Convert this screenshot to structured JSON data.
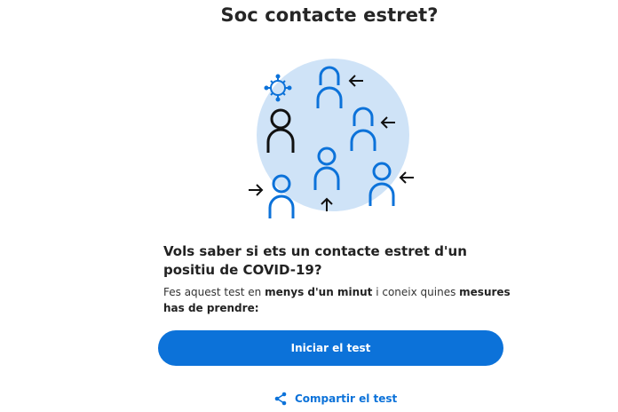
{
  "page": {
    "title": "Soc contacte estret?"
  },
  "illustration": {
    "icons": [
      "virus-icon",
      "infected-person-icon",
      "contact-person-icon",
      "arrow-icon"
    ],
    "colors": {
      "circle": "#cfe3f7",
      "contact": "#0c72d9",
      "infected": "#111111",
      "virus": "#0c72d9"
    }
  },
  "main": {
    "question": "Vols saber si ets un contacte estret d'un positiu de COVID-19?",
    "description": {
      "part1": "Fes aquest test en ",
      "bold1": "menys d'un minut",
      "part2": " i coneix quines ",
      "bold2": "mesures has de prendre:"
    }
  },
  "actions": {
    "start_label": "Iniciar el test",
    "share_label": "Compartir el test",
    "share_icon": "share-icon"
  },
  "colors": {
    "accent": "#0c72d9",
    "text": "#222222"
  }
}
